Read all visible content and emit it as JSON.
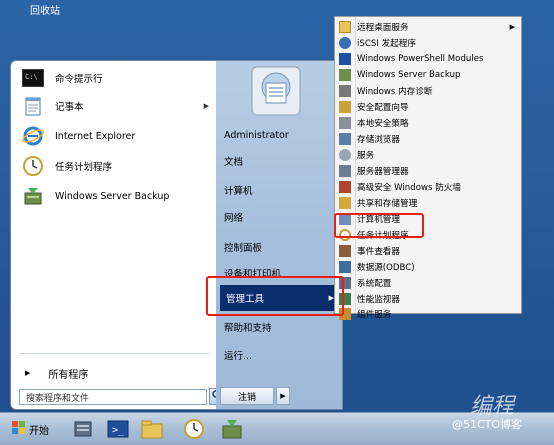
{
  "desktop": {
    "recycle_bin": "回收站"
  },
  "left_pane": {
    "items": [
      {
        "label": "命令提示行",
        "icon": "cmd-icon"
      },
      {
        "label": "记事本",
        "icon": "notepad-icon",
        "has_submenu": true
      },
      {
        "label": "Internet Explorer",
        "icon": "ie-icon"
      },
      {
        "label": "任务计划程序",
        "icon": "clock-icon"
      },
      {
        "label": "Windows Server Backup",
        "icon": "backup-icon"
      }
    ],
    "all_programs": "所有程序",
    "search_placeholder": "搜索程序和文件"
  },
  "right_pane": {
    "items": [
      {
        "label": "Administrator"
      },
      {
        "label": "文档"
      },
      {
        "label": "计算机"
      },
      {
        "label": "网络"
      },
      {
        "label": "控制面板"
      },
      {
        "label": "设备和打印机"
      },
      {
        "label": "管理工具",
        "highlighted": true,
        "has_submenu": true
      },
      {
        "label": "帮助和支持"
      },
      {
        "label": "运行..."
      }
    ],
    "shutdown": "注销"
  },
  "submenu": {
    "items": [
      {
        "label": "远程桌面服务",
        "icon": "folder-icon",
        "has_submenu": true
      },
      {
        "label": "iSCSI 发起程序",
        "icon": "iscsi-icon"
      },
      {
        "label": "Windows PowerShell Modules",
        "icon": "powershell-icon"
      },
      {
        "label": "Windows Server Backup",
        "icon": "backup-icon"
      },
      {
        "label": "Windows 内存诊断",
        "icon": "memory-icon"
      },
      {
        "label": "安全配置向导",
        "icon": "security-wizard-icon"
      },
      {
        "label": "本地安全策略",
        "icon": "policy-icon"
      },
      {
        "label": "存储浏览器",
        "icon": "storage-icon"
      },
      {
        "label": "服务",
        "icon": "services-icon"
      },
      {
        "label": "服务器管理器",
        "icon": "server-manager-icon"
      },
      {
        "label": "高级安全 Windows 防火墙",
        "icon": "firewall-icon"
      },
      {
        "label": "共享和存储管理",
        "icon": "share-icon"
      },
      {
        "label": "计算机管理",
        "icon": "computer-mgmt-icon"
      },
      {
        "label": "任务计划程序",
        "icon": "clock-icon"
      },
      {
        "label": "事件查看器",
        "icon": "event-viewer-icon"
      },
      {
        "label": "数据源(ODBC)",
        "icon": "odbc-icon"
      },
      {
        "label": "系统配置",
        "icon": "sysconfig-icon"
      },
      {
        "label": "性能监视器",
        "icon": "perfmon-icon"
      },
      {
        "label": "组件服务",
        "icon": "component-icon"
      }
    ]
  },
  "taskbar": {
    "start_label": "开始"
  },
  "watermark": "@51CTO博客",
  "watermark_big": "编程"
}
